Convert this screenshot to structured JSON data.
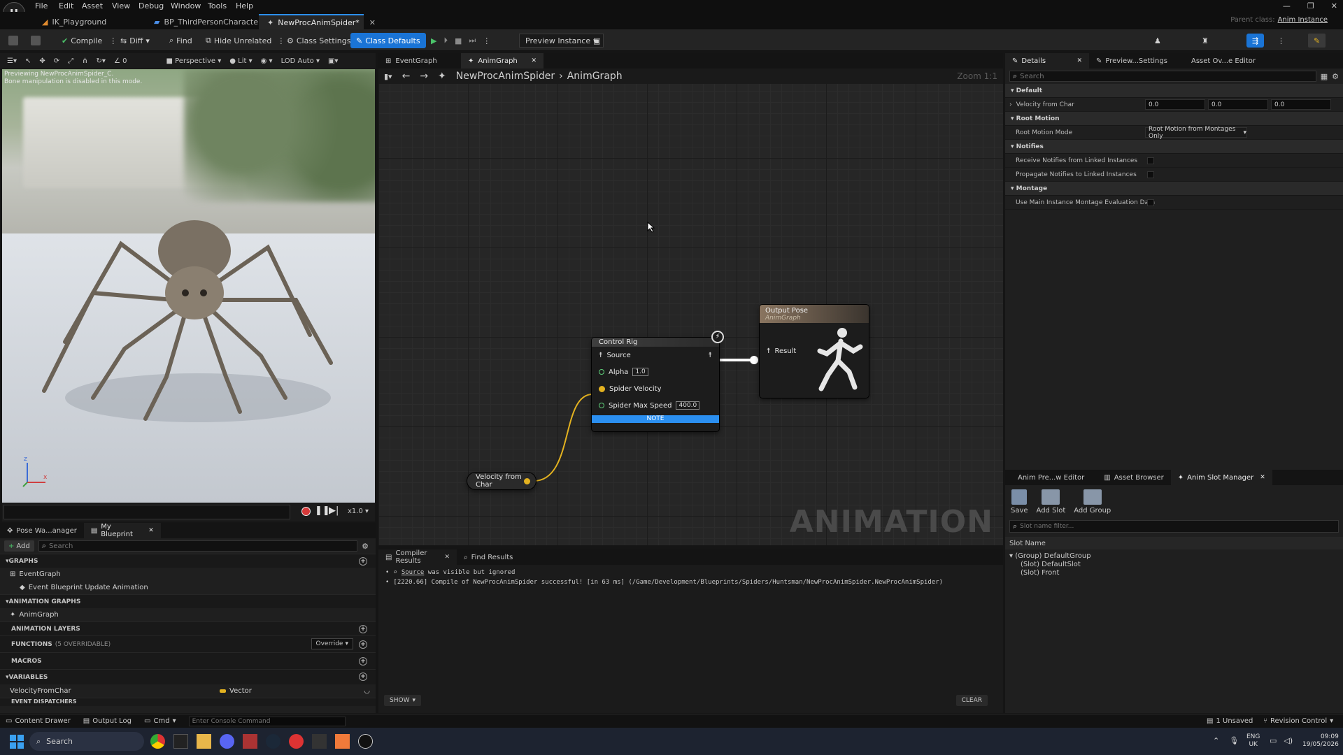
{
  "menu": [
    "File",
    "Edit",
    "Asset",
    "View",
    "Debug",
    "Window",
    "Tools",
    "Help"
  ],
  "doc_tabs": [
    {
      "label": "IK_Playground"
    },
    {
      "label": "BP_ThirdPersonCharacter"
    },
    {
      "label": "NewProcAnimSpider*"
    }
  ],
  "parent_class": {
    "label": "Parent class:",
    "value": "Anim Instance"
  },
  "toolbar": {
    "compile": "Compile",
    "diff": "Diff",
    "find": "Find",
    "hide_unrelated": "Hide Unrelated",
    "class_settings": "Class Settings",
    "class_defaults": "Class Defaults",
    "preview_instance": "Preview Instance"
  },
  "viewport": {
    "perspective": "Perspective",
    "lit": "Lit",
    "lod": "LOD Auto",
    "view_mode": "0",
    "overlay_line1": "Previewing NewProcAnimSpider_C.",
    "overlay_line2": "Bone manipulation is disabled in this mode.",
    "speed": "x1.0",
    "axis_x": "x",
    "axis_z": "z"
  },
  "left_tabs": [
    {
      "label": "Pose Wa...anager"
    },
    {
      "label": "My Blueprint"
    }
  ],
  "my_blueprint": {
    "add": "Add",
    "search_placeholder": "Search",
    "graphs_header": "GRAPHS",
    "event_graph": "EventGraph",
    "event_update": "Event Blueprint Update Animation",
    "anim_graphs_header": "ANIMATION GRAPHS",
    "anim_graph": "AnimGraph",
    "anim_layers_header": "ANIMATION LAYERS",
    "functions_header": "FUNCTIONS",
    "functions_count": "(5 OVERRIDABLE)",
    "override": "Override",
    "macros_header": "MACROS",
    "variables_header": "VARIABLES",
    "var_name": "VelocityFromChar",
    "var_type": "Vector",
    "event_dispatchers": "EVENT DISPATCHERS"
  },
  "graph_tabs": [
    {
      "label": "EventGraph"
    },
    {
      "label": "AnimGraph"
    }
  ],
  "graph": {
    "breadcrumb_root": "NewProcAnimSpider",
    "breadcrumb_leaf": "AnimGraph",
    "zoom": "Zoom 1:1",
    "watermark": "ANIMATION",
    "control_rig": {
      "title": "Control Rig",
      "source": "Source",
      "alpha": "Alpha",
      "alpha_value": "1.0",
      "spider_velocity": "Spider Velocity",
      "spider_max_speed": "Spider Max Speed",
      "max_speed_value": "400.0",
      "note": "NOTE"
    },
    "output_pose": {
      "title": "Output Pose",
      "subtitle": "AnimGraph",
      "result": "Result"
    },
    "velocity_node": "Velocity from Char"
  },
  "compiler": {
    "tab": "Compiler Results",
    "find_tab": "Find Results",
    "line1_ident": "Source",
    "line1_rest": " was visible but ignored",
    "line2": "[2220.66] Compile of NewProcAnimSpider successful! [in 63 ms] (/Game/Development/Blueprints/Spiders/Huntsman/NewProcAnimSpider.NewProcAnimSpider)",
    "show": "SHOW",
    "clear": "CLEAR"
  },
  "details_tabs": [
    {
      "label": "Details"
    },
    {
      "label": "Preview...Settings"
    },
    {
      "label": "Asset Ov...e Editor"
    }
  ],
  "details": {
    "search_placeholder": "Search",
    "cat_default": "Default",
    "velocity_label": "Velocity from Char",
    "vx": "0.0",
    "vy": "0.0",
    "vz": "0.0",
    "cat_root_motion": "Root Motion",
    "root_motion_mode_label": "Root Motion Mode",
    "root_motion_mode_value": "Root Motion from Montages Only",
    "cat_notifies": "Notifies",
    "receive_notifies": "Receive Notifies from Linked Instances",
    "propagate_notifies": "Propagate Notifies to Linked Instances",
    "cat_montage": "Montage",
    "use_main_instance": "Use Main Instance Montage Evaluation Data"
  },
  "slot_tabs": [
    {
      "label": "Anim Pre...w Editor"
    },
    {
      "label": "Asset Browser"
    },
    {
      "label": "Anim Slot Manager"
    }
  ],
  "slot_manager": {
    "save": "Save",
    "add_slot": "Add Slot",
    "add_group": "Add Group",
    "filter_placeholder": "Slot name filter...",
    "header": "Slot Name",
    "group": "(Group) DefaultGroup",
    "slot1": "(Slot) DefaultSlot",
    "slot2": "(Slot) Front"
  },
  "statusbar": {
    "content_drawer": "Content Drawer",
    "output_log": "Output Log",
    "cmd": "Cmd",
    "console_placeholder": "Enter Console Command",
    "unsaved": "1 Unsaved",
    "revision": "Revision Control"
  },
  "taskbar": {
    "search": "Search",
    "lang1": "ENG",
    "lang2": "UK",
    "time": "09:09",
    "date": "19/05/2026"
  },
  "colors": {
    "accent": "#1a74d6",
    "node_header": "#3a3a3a",
    "pin_struct": "#e3b220",
    "pin_exec": "#5fd07a"
  }
}
